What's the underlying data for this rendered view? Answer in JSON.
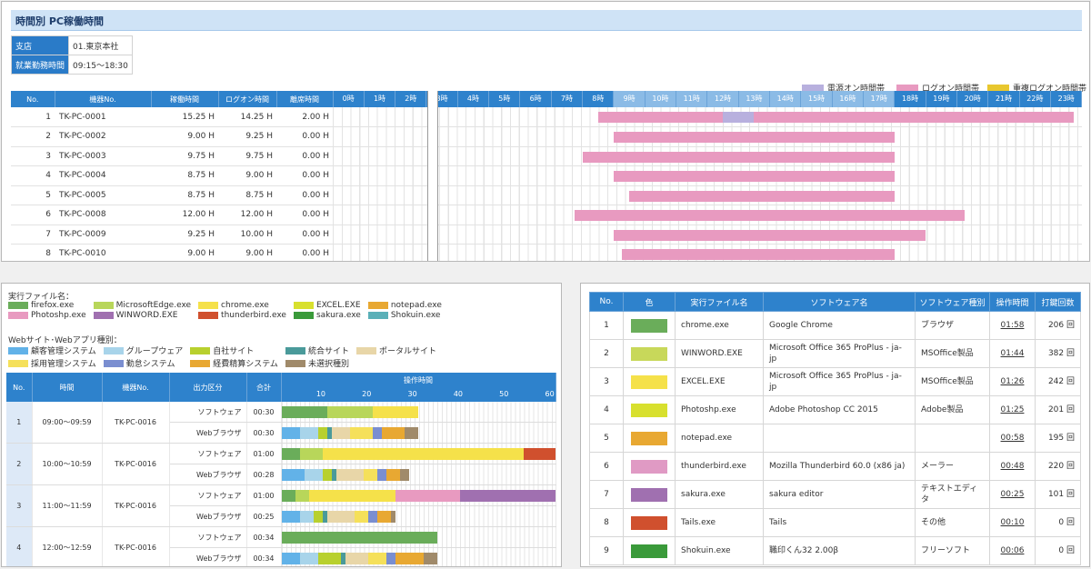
{
  "top": {
    "title": "時間別 PC稼働時間",
    "branch_label": "支店",
    "branch_value": "01.東京本社",
    "hours_label": "就業勤務時間",
    "hours_value": "09:15～18:30",
    "legend": [
      {
        "label": "電源オン時間帯",
        "color": "#b8b0de"
      },
      {
        "label": "ログオン時間帯",
        "color": "#e89ac0"
      },
      {
        "label": "重複ログオン時間帯",
        "color": "#e8c72e"
      }
    ],
    "headers": {
      "no": "No.",
      "pc": "機器No.",
      "run": "稼働時間",
      "logon": "ログオン時間",
      "away": "離席時間"
    },
    "hour_labels": [
      "0時",
      "1時",
      "2時",
      "3時",
      "4時",
      "5時",
      "6時",
      "7時",
      "8時",
      "9時",
      "10時",
      "11時",
      "12時",
      "13時",
      "14時",
      "15時",
      "16時",
      "17時",
      "18時",
      "19時",
      "20時",
      "21時",
      "22時",
      "23時"
    ],
    "highlight_hours": [
      9,
      10,
      11,
      12,
      13,
      14,
      15,
      16,
      17
    ],
    "rows": [
      {
        "no": "1",
        "pc": "TK-PC-0001",
        "run": "15.25 H",
        "logon": "14.25 H",
        "away": "2.00 H",
        "start": 8.5,
        "end": 23.75,
        "idle_start": 12.5,
        "idle_end": 13.5
      },
      {
        "no": "2",
        "pc": "TK-PC-0002",
        "run": "9.00 H",
        "logon": "9.25 H",
        "away": "0.00 H",
        "start": 9.0,
        "end": 18.0
      },
      {
        "no": "3",
        "pc": "TK-PC-0003",
        "run": "9.75 H",
        "logon": "9.75 H",
        "away": "0.00 H",
        "start": 8.0,
        "end": 18.0
      },
      {
        "no": "4",
        "pc": "TK-PC-0004",
        "run": "8.75 H",
        "logon": "9.00 H",
        "away": "0.00 H",
        "start": 9.0,
        "end": 18.0
      },
      {
        "no": "5",
        "pc": "TK-PC-0005",
        "run": "8.75 H",
        "logon": "8.75 H",
        "away": "0.00 H",
        "start": 9.5,
        "end": 18.0
      },
      {
        "no": "6",
        "pc": "TK-PC-0008",
        "run": "12.00 H",
        "logon": "12.00 H",
        "away": "0.00 H",
        "start": 7.75,
        "end": 20.25
      },
      {
        "no": "7",
        "pc": "TK-PC-0009",
        "run": "9.25 H",
        "logon": "10.00 H",
        "away": "0.00 H",
        "start": 9.0,
        "end": 19.0
      },
      {
        "no": "8",
        "pc": "TK-PC-0010",
        "run": "9.00 H",
        "logon": "9.00 H",
        "away": "0.00 H",
        "start": 9.25,
        "end": 18.0
      }
    ]
  },
  "ops": {
    "exe_title": "実行ファイル名：",
    "exe_legend": [
      {
        "label": "firefox.exe",
        "color": "#6aad5a"
      },
      {
        "label": "MicrosoftEdge.exe",
        "color": "#b8d65a"
      },
      {
        "label": "chrome.exe",
        "color": "#f5e14a"
      },
      {
        "label": "EXCEL.EXE",
        "color": "#d8e02e"
      },
      {
        "label": "notepad.exe",
        "color": "#e8a832"
      },
      {
        "label": "Photoshp.exe",
        "color": "#e89ac0"
      },
      {
        "label": "WINWORD.EXE",
        "color": "#a070b0"
      },
      {
        "label": "thunderbird.exe",
        "color": "#d0502e"
      },
      {
        "label": "sakura.exe",
        "color": "#3a9a3a"
      },
      {
        "label": "Shokuin.exe",
        "color": "#5ab0b8"
      }
    ],
    "web_title": "Webサイト･Webアプリ種別：",
    "web_legend": [
      {
        "label": "顧客管理システム",
        "color": "#62b2e8"
      },
      {
        "label": "グループウェア",
        "color": "#a8d4ea"
      },
      {
        "label": "自社サイト",
        "color": "#b8d02e"
      },
      {
        "label": "統合サイト",
        "color": "#4a9a9a"
      },
      {
        "label": "ポータルサイト",
        "color": "#e8d6a8"
      },
      {
        "label": "採用管理システム",
        "color": "#f5e05a"
      },
      {
        "label": "勤怠システム",
        "color": "#7a8ed0"
      },
      {
        "label": "経費精算システム",
        "color": "#e8a832"
      },
      {
        "label": "未選択種別",
        "color": "#a08a6a"
      }
    ],
    "headers": {
      "no": "No.",
      "time": "時間",
      "pc": "機器No.",
      "kind": "出力区分",
      "total": "合計",
      "optime": "操作時間"
    },
    "axis_ticks": [
      10,
      20,
      30,
      40,
      50,
      60
    ],
    "axis_max": 60,
    "rows": [
      {
        "no": "1",
        "time": "09:00～09:59",
        "pc": "TK-PC-0016",
        "sw_label": "ソフトウェア",
        "sw_total": "00:30",
        "web_label": "Webブラウザ",
        "web_total": "00:30",
        "sw_segments": [
          {
            "color": "#6aad5a",
            "minutes": 10
          },
          {
            "color": "#b8d65a",
            "minutes": 10
          },
          {
            "color": "#f5e14a",
            "minutes": 10
          }
        ],
        "web_segments": [
          {
            "color": "#62b2e8",
            "minutes": 4
          },
          {
            "color": "#a8d4ea",
            "minutes": 4
          },
          {
            "color": "#b8d02e",
            "minutes": 2
          },
          {
            "color": "#4a9a9a",
            "minutes": 1
          },
          {
            "color": "#e8d6a8",
            "minutes": 4
          },
          {
            "color": "#f5e05a",
            "minutes": 5
          },
          {
            "color": "#7a8ed0",
            "minutes": 2
          },
          {
            "color": "#e8a832",
            "minutes": 5
          },
          {
            "color": "#a08a6a",
            "minutes": 3
          }
        ]
      },
      {
        "no": "2",
        "time": "10:00～10:59",
        "pc": "TK-PC-0016",
        "sw_label": "ソフトウェア",
        "sw_total": "01:00",
        "web_label": "Webブラウザ",
        "web_total": "00:28",
        "sw_segments": [
          {
            "color": "#6aad5a",
            "minutes": 4
          },
          {
            "color": "#b8d65a",
            "minutes": 5
          },
          {
            "color": "#f5e14a",
            "minutes": 44
          },
          {
            "color": "#d0502e",
            "minutes": 7
          }
        ],
        "web_segments": [
          {
            "color": "#62b2e8",
            "minutes": 5
          },
          {
            "color": "#a8d4ea",
            "minutes": 4
          },
          {
            "color": "#b8d02e",
            "minutes": 2
          },
          {
            "color": "#4a9a9a",
            "minutes": 1
          },
          {
            "color": "#e8d6a8",
            "minutes": 6
          },
          {
            "color": "#f5e05a",
            "minutes": 3
          },
          {
            "color": "#7a8ed0",
            "minutes": 2
          },
          {
            "color": "#e8a832",
            "minutes": 3
          },
          {
            "color": "#a08a6a",
            "minutes": 2
          }
        ]
      },
      {
        "no": "3",
        "time": "11:00～11:59",
        "pc": "TK-PC-0016",
        "sw_label": "ソフトウェア",
        "sw_total": "01:00",
        "web_label": "Webブラウザ",
        "web_total": "00:25",
        "sw_segments": [
          {
            "color": "#6aad5a",
            "minutes": 3
          },
          {
            "color": "#b8d65a",
            "minutes": 3
          },
          {
            "color": "#f5e14a",
            "minutes": 19
          },
          {
            "color": "#e89ac0",
            "minutes": 14
          },
          {
            "color": "#a070b0",
            "minutes": 21
          }
        ],
        "web_segments": [
          {
            "color": "#62b2e8",
            "minutes": 4
          },
          {
            "color": "#a8d4ea",
            "minutes": 3
          },
          {
            "color": "#b8d02e",
            "minutes": 2
          },
          {
            "color": "#4a9a9a",
            "minutes": 1
          },
          {
            "color": "#e8d6a8",
            "minutes": 6
          },
          {
            "color": "#f5e05a",
            "minutes": 3
          },
          {
            "color": "#7a8ed0",
            "minutes": 2
          },
          {
            "color": "#e8a832",
            "minutes": 3
          },
          {
            "color": "#a08a6a",
            "minutes": 1
          }
        ]
      },
      {
        "no": "4",
        "time": "12:00～12:59",
        "pc": "TK-PC-0016",
        "sw_label": "ソフトウェア",
        "sw_total": "00:34",
        "web_label": "Webブラウザ",
        "web_total": "00:34",
        "sw_segments": [
          {
            "color": "#6aad5a",
            "minutes": 34
          }
        ],
        "web_segments": [
          {
            "color": "#62b2e8",
            "minutes": 4
          },
          {
            "color": "#a8d4ea",
            "minutes": 4
          },
          {
            "color": "#b8d02e",
            "minutes": 5
          },
          {
            "color": "#4a9a9a",
            "minutes": 1
          },
          {
            "color": "#e8d6a8",
            "minutes": 5
          },
          {
            "color": "#f5e05a",
            "minutes": 4
          },
          {
            "color": "#7a8ed0",
            "minutes": 2
          },
          {
            "color": "#e8a832",
            "minutes": 6
          },
          {
            "color": "#a08a6a",
            "minutes": 3
          }
        ]
      }
    ]
  },
  "rank": {
    "headers": {
      "no": "No.",
      "color": "色",
      "exe": "実行ファイル名",
      "software": "ソフトウェア名",
      "kind": "ソフトウェア種別",
      "time": "操作時間",
      "count": "打鍵回数"
    },
    "rows": [
      {
        "no": "1",
        "color": "#6aad5a",
        "exe": "chrome.exe",
        "software": "Google Chrome",
        "kind": "ブラウザ",
        "time": "01:58",
        "count": "206 回"
      },
      {
        "no": "2",
        "color": "#c8d85a",
        "exe": "WINWORD.EXE",
        "software": "Microsoft Office 365 ProPlus - ja- jp",
        "kind": "MSOffice製品",
        "time": "01:44",
        "count": "382 回"
      },
      {
        "no": "3",
        "color": "#f5e14a",
        "exe": "EXCEL.EXE",
        "software": "Microsoft Office 365 ProPlus - ja- jp",
        "kind": "MSOffice製品",
        "time": "01:26",
        "count": "242 回"
      },
      {
        "no": "4",
        "color": "#d8e02e",
        "exe": "Photoshp.exe",
        "software": "Adobe Photoshop CC 2015",
        "kind": "Adobe製品",
        "time": "01:25",
        "count": "201 回"
      },
      {
        "no": "5",
        "color": "#e8a832",
        "exe": "notepad.exe",
        "software": "",
        "kind": "",
        "time": "00:58",
        "count": "195 回"
      },
      {
        "no": "6",
        "color": "#e09ac4",
        "exe": "thunderbird.exe",
        "software": "Mozilla Thunderbird 60.0 (x86 ja)",
        "kind": "メーラー",
        "time": "00:48",
        "count": "220 回"
      },
      {
        "no": "7",
        "color": "#a070b0",
        "exe": "sakura.exe",
        "software": "sakura editor",
        "kind": "テキストエディタ",
        "time": "00:25",
        "count": "101 回"
      },
      {
        "no": "8",
        "color": "#d0502e",
        "exe": "Tails.exe",
        "software": "Tails",
        "kind": "その他",
        "time": "00:10",
        "count": "0 回"
      },
      {
        "no": "9",
        "color": "#3a9a3a",
        "exe": "Shokuin.exe",
        "software": "職印くん32 2.00β",
        "kind": "フリーソフト",
        "time": "00:06",
        "count": "0 回"
      }
    ]
  }
}
